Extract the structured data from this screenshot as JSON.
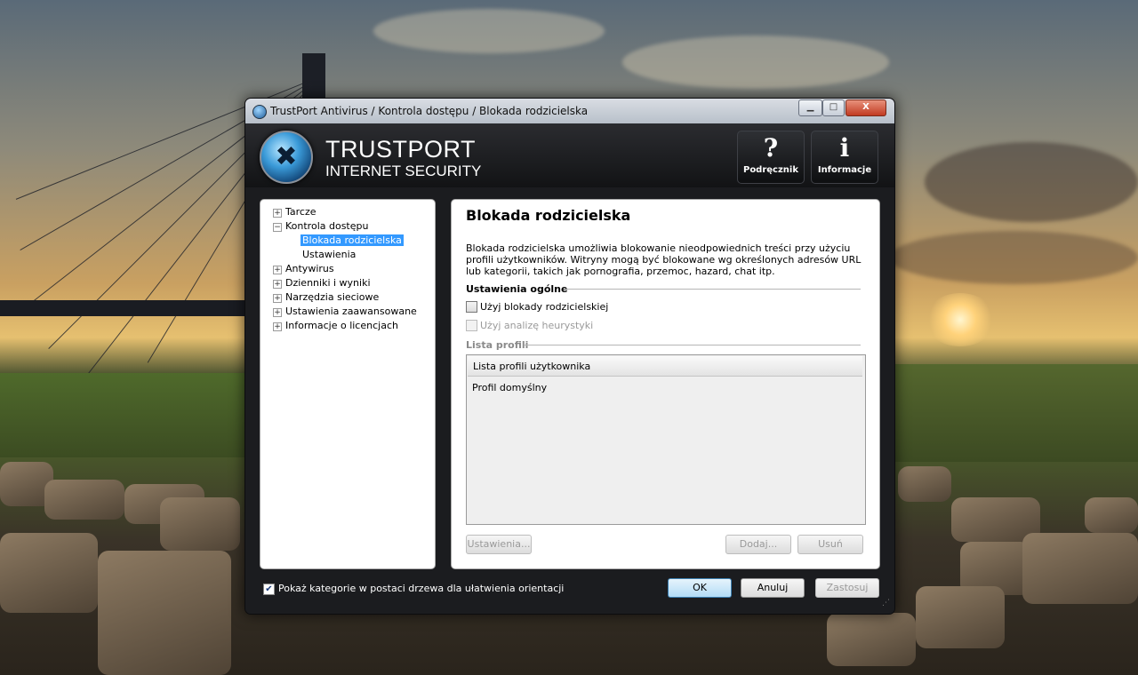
{
  "window": {
    "title": "TrustPort Antivirus / Kontrola dostępu / Blokada rodzicielska",
    "minimize_glyph": "▁",
    "maximize_glyph": "□",
    "close_glyph": "X"
  },
  "header": {
    "brand_line1": "TRUSTPORT",
    "brand_line2": "INTERNET SECURITY",
    "logo_icon": "tools-icon",
    "help_button": {
      "symbol": "?",
      "label": "Podręcznik"
    },
    "info_button": {
      "symbol": "i",
      "label": "Informacje"
    }
  },
  "tree": {
    "items": [
      {
        "label": "Tarcze",
        "expander": "+"
      },
      {
        "label": "Kontrola dostępu",
        "expander": "−"
      },
      {
        "label": "Blokada rodzicielska"
      },
      {
        "label": "Ustawienia"
      },
      {
        "label": "Antywirus",
        "expander": "+"
      },
      {
        "label": "Dzienniki i wyniki",
        "expander": "+"
      },
      {
        "label": "Narzędzia sieciowe",
        "expander": "+"
      },
      {
        "label": "Ustawienia zaawansowane",
        "expander": "+"
      },
      {
        "label": "Informacje o licencjach",
        "expander": "+"
      }
    ],
    "selected": "Blokada rodzicielska"
  },
  "content": {
    "title": "Blokada rodzicielska",
    "description": "Blokada rodzicielska umożliwia blokowanie nieodpowiednich treści przy użyciu profili użytkowników. Witryny mogą być blokowane wg określonych adresów URL lub kategorii, takich jak pornografia, przemoc, hazard, chat itp.",
    "general_section": "Ustawienia ogólne",
    "use_parental_block": {
      "label": "Użyj blokady rodzicielskiej",
      "checked": false
    },
    "use_heuristics": {
      "label": "Użyj analizę heurystyki",
      "checked": false,
      "disabled": true
    },
    "profiles_section": "Lista profili",
    "profiles_header": "Lista profili użytkownika",
    "profiles": [
      "Profil domyślny"
    ],
    "settings_button": "Ustawienia...",
    "add_button": "Dodaj...",
    "remove_button": "Usuń"
  },
  "footer": {
    "tree_view_checkbox": {
      "label": "Pokaż kategorie w postaci drzewa dla ułatwienia orientacji",
      "checked": true,
      "glyph": "✔"
    },
    "ok": "OK",
    "cancel": "Anuluj",
    "apply": "Zastosuj"
  }
}
